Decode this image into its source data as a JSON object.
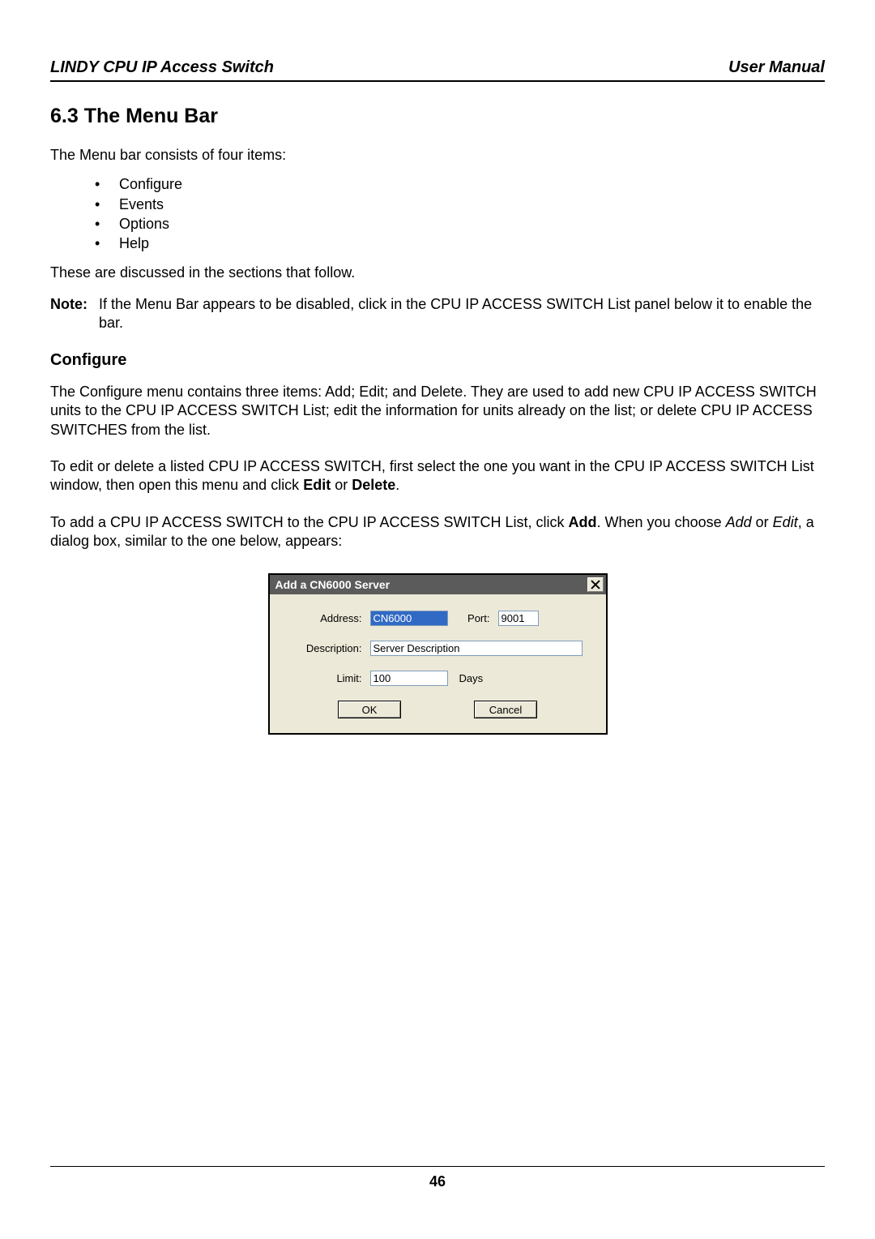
{
  "header": {
    "left": "LINDY CPU IP Access Switch",
    "right": "User Manual"
  },
  "section": {
    "title": "6.3 The Menu Bar",
    "intro": "The Menu bar consists of four items:",
    "bullets": [
      "Configure",
      "Events",
      "Options",
      "Help"
    ],
    "after_bullets": "These are discussed in the sections that follow.",
    "note_label": "Note:",
    "note_text": "If the Menu Bar appears to be disabled, click in the CPU IP ACCESS SWITCH List panel below it to enable the bar."
  },
  "sub": {
    "title": "Configure",
    "p1": "The Configure menu contains three items: Add; Edit; and Delete. They are used to add new CPU IP ACCESS SWITCH units to the CPU IP ACCESS SWITCH List; edit the information for units already on the list; or delete CPU IP ACCESS SWITCHES from the list.",
    "p2_pre": "To edit or delete a listed CPU IP ACCESS SWITCH, first select the one you want in the CPU IP ACCESS SWITCH List window, then open this menu and click ",
    "p2_b1": "Edit",
    "p2_mid": " or ",
    "p2_b2": "Delete",
    "p2_post": ".",
    "p3_pre": "To add a CPU IP ACCESS SWITCH to the CPU IP ACCESS SWITCH List, click ",
    "p3_b1": "Add",
    "p3_mid": ". When you choose ",
    "p3_i1": "Add",
    "p3_mid2": " or ",
    "p3_i2": "Edit",
    "p3_post": ", a dialog box, similar to the one below, appears:"
  },
  "dialog": {
    "title": "Add a CN6000 Server",
    "labels": {
      "address": "Address:",
      "port": "Port:",
      "description": "Description:",
      "limit": "Limit:",
      "days": "Days"
    },
    "values": {
      "address": "CN6000",
      "port": "9001",
      "description": "Server Description",
      "limit": "100"
    },
    "buttons": {
      "ok": "OK",
      "cancel": "Cancel"
    }
  },
  "page_number": "46"
}
